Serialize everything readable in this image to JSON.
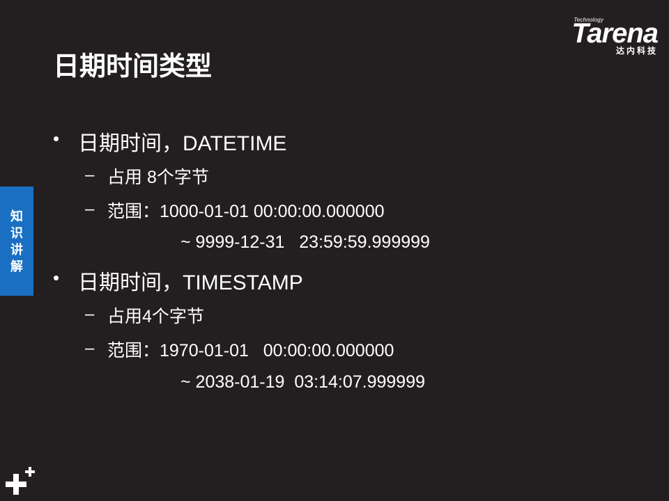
{
  "logo": {
    "technology": "Technology",
    "brand": "Tarena",
    "chinese": "达内科技"
  },
  "title": "日期时间类型",
  "side_tab": "知识讲解",
  "sections": [
    {
      "heading": "日期时间，DATETIME",
      "items": [
        "占用 8个字节",
        "范围：1000-01-01 00:00:00.000000"
      ],
      "continuation": "~ 9999-12-31   23:59:59.999999"
    },
    {
      "heading": "日期时间，TIMESTAMP",
      "items": [
        "占用4个字节",
        "范围：1970-01-01   00:00:00.000000"
      ],
      "continuation": "~ 2038-01-19  03:14:07.999999"
    }
  ],
  "symbols": {
    "bullet": "•",
    "dash": "–"
  },
  "icons": {
    "plus": "plus-icon"
  },
  "colors": {
    "background": "#231f20",
    "side_tab": "#1a6fc2",
    "text": "#ffffff"
  }
}
